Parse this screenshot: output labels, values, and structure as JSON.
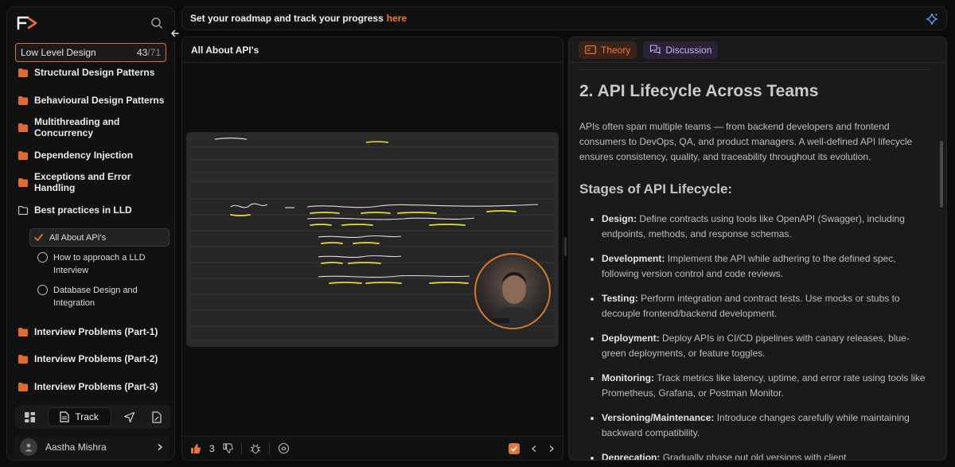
{
  "sidebar": {
    "course": {
      "title": "Low Level Design",
      "done": "43",
      "sep": "/",
      "total": "71"
    },
    "sections": [
      {
        "label": "Structural Design Patterns"
      },
      {
        "label": "Behavioural Design Patterns"
      },
      {
        "label": "Multithreading and Concurrency"
      },
      {
        "label": "Dependency Injection"
      },
      {
        "label": "Exceptions and Error Handling"
      },
      {
        "label": "Best practices in LLD"
      }
    ],
    "subitems": [
      {
        "label": "All About API's",
        "state": "done"
      },
      {
        "label": "How to approach a LLD Interview",
        "state": "todo"
      },
      {
        "label": "Database Design and Integration",
        "state": "todo"
      }
    ],
    "more_sections": [
      {
        "label": "Interview Problems (Part-1)"
      },
      {
        "label": "Interview Problems (Part-2)"
      },
      {
        "label": "Interview Problems (Part-3)"
      }
    ],
    "tabbar": {
      "track_label": "Track"
    },
    "user": {
      "name": "Aastha Mishra"
    }
  },
  "banner": {
    "text": "Set your roadmap and track your progress",
    "link": "here"
  },
  "video_panel": {
    "title": "All About API's",
    "likes": "3"
  },
  "theory_panel": {
    "tabs": {
      "theory": "Theory",
      "discussion": "Discussion"
    },
    "heading": "2. API Lifecycle Across Teams",
    "intro": "APIs often span multiple teams — from backend developers and frontend consumers to DevOps, QA, and product managers. A well-defined API lifecycle ensures consistency, quality, and traceability throughout its evolution.",
    "subheading": "Stages of API Lifecycle:",
    "stages": [
      {
        "term": "Design:",
        "desc": "Define contracts using tools like OpenAPI (Swagger), including endpoints, methods, and response schemas."
      },
      {
        "term": "Development:",
        "desc": "Implement the API while adhering to the defined spec, following version control and code reviews."
      },
      {
        "term": "Testing:",
        "desc": "Perform integration and contract tests. Use mocks or stubs to decouple frontend/backend development."
      },
      {
        "term": "Deployment:",
        "desc": "Deploy APIs in CI/CD pipelines with canary releases, blue-green deployments, or feature toggles."
      },
      {
        "term": "Monitoring:",
        "desc": "Track metrics like latency, uptime, and error rate using tools like Prometheus, Grafana, or Postman Monitor."
      },
      {
        "term": "Versioning/Maintenance:",
        "desc": "Introduce changes carefully while maintaining backward compatibility."
      },
      {
        "term": "Deprecation:",
        "desc": "Gradually phase out old versions with client"
      }
    ]
  },
  "colors": {
    "accent": "#ef7a3a",
    "background": "#0b0b0c",
    "panel": "#111112",
    "discussion": "#c8b5f0"
  }
}
